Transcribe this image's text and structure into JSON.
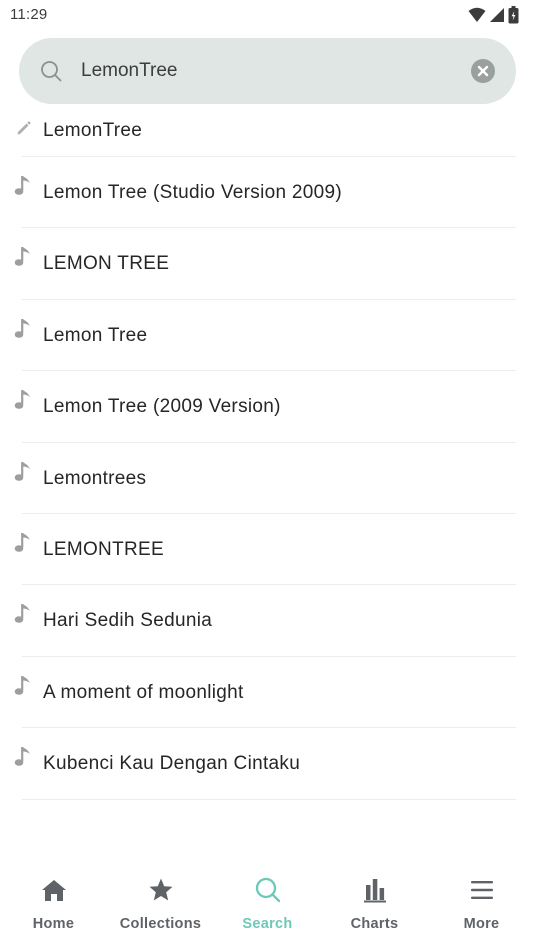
{
  "status_bar": {
    "time": "11:29",
    "icons": [
      "wifi-icon",
      "cellular-signal-icon",
      "battery-icon"
    ]
  },
  "search": {
    "query": "LemonTree",
    "icon": "search-icon",
    "clear_icon": "clear-icon"
  },
  "results": [
    {
      "icon": "pencil-icon",
      "label": "LemonTree"
    },
    {
      "icon": "music-note-icon",
      "label": "Lemon Tree (Studio Version 2009)"
    },
    {
      "icon": "music-note-icon",
      "label": "LEMON TREE"
    },
    {
      "icon": "music-note-icon",
      "label": "Lemon Tree"
    },
    {
      "icon": "music-note-icon",
      "label": "Lemon Tree (2009 Version)"
    },
    {
      "icon": "music-note-icon",
      "label": "Lemontrees"
    },
    {
      "icon": "music-note-icon",
      "label": "LEMONTREE"
    },
    {
      "icon": "music-note-icon",
      "label": "Hari Sedih Sedunia"
    },
    {
      "icon": "music-note-icon",
      "label": "A moment of moonlight"
    },
    {
      "icon": "music-note-icon",
      "label": "Kubenci Kau Dengan Cintaku"
    }
  ],
  "bottom_nav": [
    {
      "icon": "home-icon",
      "label": "Home",
      "active": false
    },
    {
      "icon": "star-icon",
      "label": "Collections",
      "active": false
    },
    {
      "icon": "search-icon",
      "label": "Search",
      "active": true
    },
    {
      "icon": "bar-chart-icon",
      "label": "Charts",
      "active": false
    },
    {
      "icon": "menu-icon",
      "label": "More",
      "active": false
    }
  ],
  "colors": {
    "accent": "#6cc9b8",
    "search_bg": "#dfe6e3",
    "icon_gray": "#9e9e9e",
    "nav_gray": "#5f6368"
  }
}
